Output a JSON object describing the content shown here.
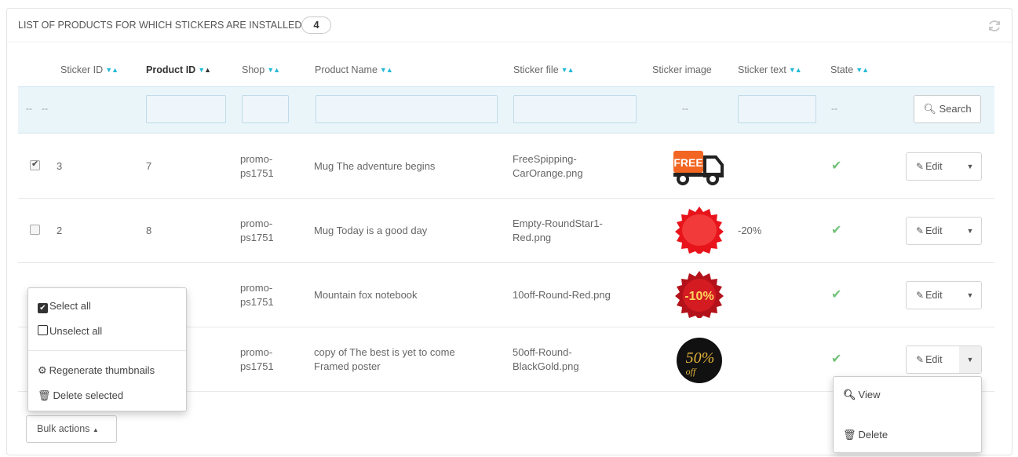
{
  "panel": {
    "title": "LIST OF PRODUCTS FOR WHICH STICKERS ARE INSTALLED",
    "count": "4"
  },
  "columns": {
    "sticker_id": "Sticker ID",
    "product_id": "Product ID",
    "shop": "Shop",
    "product_name": "Product Name",
    "sticker_file": "Sticker file",
    "sticker_image": "Sticker image",
    "sticker_text": "Sticker text",
    "state": "State"
  },
  "filters": {
    "dash": "--",
    "search_label": "Search"
  },
  "rows": [
    {
      "checked": true,
      "sticker_id": "3",
      "product_id": "7",
      "shop": "promo-ps1751",
      "product_name": "Mug The adventure begins",
      "sticker_file": "FreeSpipping-CarOrange.png",
      "sticker_text": "",
      "sticker_image": "free-shipping-truck-orange",
      "sticker_label": "FREE"
    },
    {
      "checked": false,
      "sticker_id": "2",
      "product_id": "8",
      "shop": "promo-ps1751",
      "product_name": "Mug Today is a good day",
      "sticker_file": "Empty-RoundStar1-Red.png",
      "sticker_text": "-20%",
      "sticker_image": "red-round-star-empty",
      "sticker_label": ""
    },
    {
      "checked": false,
      "sticker_id": "",
      "product_id": "",
      "shop": "promo-ps1751",
      "product_name": "Mountain fox notebook",
      "sticker_file": "10off-Round-Red.png",
      "sticker_text": "",
      "sticker_image": "red-round-star-10off",
      "sticker_label": "-10%"
    },
    {
      "checked": false,
      "sticker_id": "",
      "product_id": "",
      "shop": "promo-ps1751",
      "product_name": "copy of The best is yet to come Framed poster",
      "sticker_file": "50off-Round-BlackGold.png",
      "sticker_image": "black-gold-round-50off",
      "sticker_text": "",
      "sticker_label": "50%",
      "sticker_sublabel": "off"
    }
  ],
  "row_actions": {
    "edit_label": "Edit",
    "menu": {
      "view": "View",
      "delete": "Delete"
    }
  },
  "bulk": {
    "button_label": "Bulk actions",
    "select_all": "Select all",
    "unselect_all": "Unselect all",
    "regenerate": "Regenerate thumbnails",
    "delete_selected": "Delete selected"
  },
  "colors": {
    "accent": "#25b9d7",
    "ok_green": "#72c279",
    "filter_bg": "#eaf5fa",
    "sticker_orange": "#f26522",
    "sticker_red": "#e8141b"
  }
}
